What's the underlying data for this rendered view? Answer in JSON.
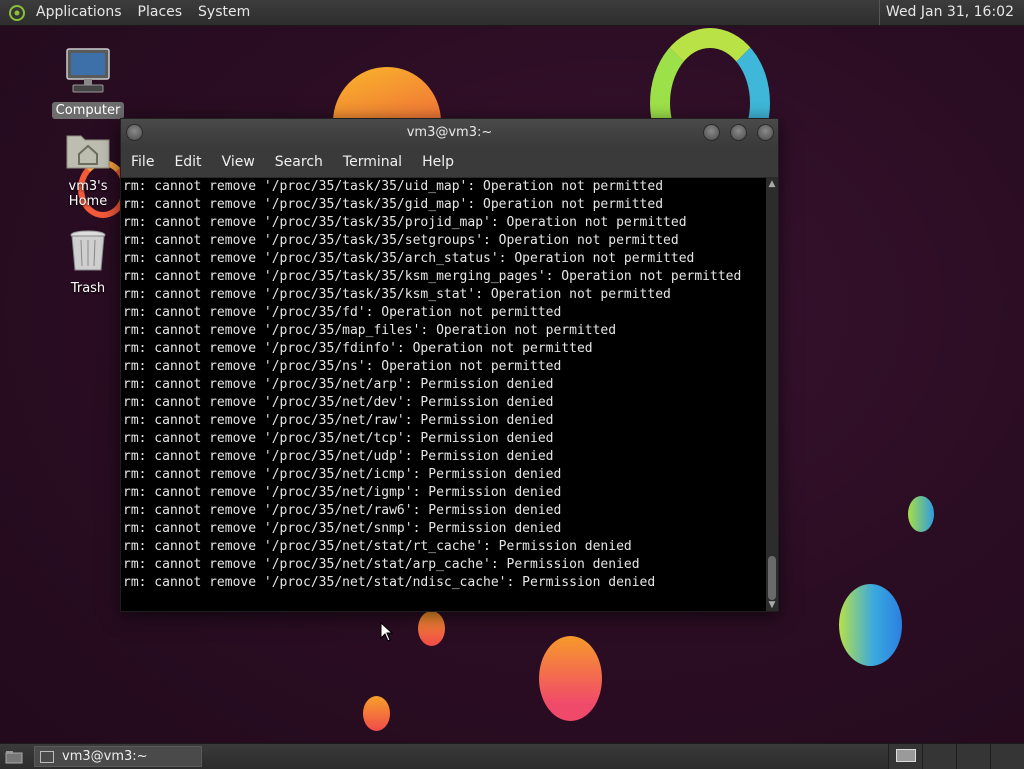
{
  "top_panel": {
    "menus": [
      "Applications",
      "Places",
      "System"
    ],
    "clock": "Wed Jan 31, 16:02"
  },
  "desktop": {
    "icons": [
      {
        "label": "Computer",
        "icon": "computer-icon"
      },
      {
        "label": "vm3's Home",
        "icon": "home-folder-icon"
      },
      {
        "label": "Trash",
        "icon": "trash-icon"
      }
    ]
  },
  "terminal": {
    "title": "vm3@vm3:~",
    "menus": [
      "File",
      "Edit",
      "View",
      "Search",
      "Terminal",
      "Help"
    ],
    "lines": [
      "rm: cannot remove '/proc/35/task/35/uid_map': Operation not permitted",
      "rm: cannot remove '/proc/35/task/35/gid_map': Operation not permitted",
      "rm: cannot remove '/proc/35/task/35/projid_map': Operation not permitted",
      "rm: cannot remove '/proc/35/task/35/setgroups': Operation not permitted",
      "rm: cannot remove '/proc/35/task/35/arch_status': Operation not permitted",
      "rm: cannot remove '/proc/35/task/35/ksm_merging_pages': Operation not permitted",
      "rm: cannot remove '/proc/35/task/35/ksm_stat': Operation not permitted",
      "rm: cannot remove '/proc/35/fd': Operation not permitted",
      "rm: cannot remove '/proc/35/map_files': Operation not permitted",
      "rm: cannot remove '/proc/35/fdinfo': Operation not permitted",
      "rm: cannot remove '/proc/35/ns': Operation not permitted",
      "rm: cannot remove '/proc/35/net/arp': Permission denied",
      "rm: cannot remove '/proc/35/net/dev': Permission denied",
      "rm: cannot remove '/proc/35/net/raw': Permission denied",
      "rm: cannot remove '/proc/35/net/tcp': Permission denied",
      "rm: cannot remove '/proc/35/net/udp': Permission denied",
      "rm: cannot remove '/proc/35/net/icmp': Permission denied",
      "rm: cannot remove '/proc/35/net/igmp': Permission denied",
      "rm: cannot remove '/proc/35/net/raw6': Permission denied",
      "rm: cannot remove '/proc/35/net/snmp': Permission denied",
      "rm: cannot remove '/proc/35/net/stat/rt_cache': Permission denied",
      "rm: cannot remove '/proc/35/net/stat/arp_cache': Permission denied",
      "rm: cannot remove '/proc/35/net/stat/ndisc_cache': Permission denied"
    ]
  },
  "bottom_panel": {
    "task_label": "vm3@vm3:~"
  }
}
